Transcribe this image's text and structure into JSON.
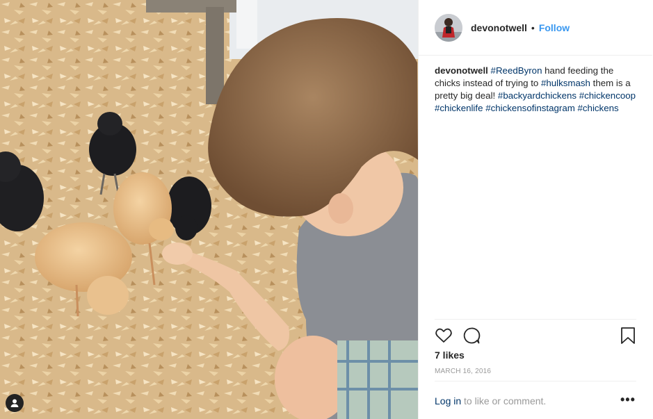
{
  "post": {
    "username": "devonotwell",
    "separator": "•",
    "follow_label": "Follow",
    "caption": {
      "username": "devonotwell",
      "parts": [
        {
          "type": "tag",
          "text": "#ReedByron"
        },
        {
          "type": "text",
          "text": " hand feeding the chicks instead of trying to "
        },
        {
          "type": "tag",
          "text": "#hulksmash"
        },
        {
          "type": "text",
          "text": " them is a pretty big deal! "
        },
        {
          "type": "tag",
          "text": "#backyardchickens"
        },
        {
          "type": "text",
          "text": " "
        },
        {
          "type": "tag",
          "text": "#chickencoop"
        },
        {
          "type": "text",
          "text": " "
        },
        {
          "type": "tag",
          "text": "#chickenlife"
        },
        {
          "type": "text",
          "text": " "
        },
        {
          "type": "tag",
          "text": "#chickensofinstagram"
        },
        {
          "type": "text",
          "text": " "
        },
        {
          "type": "tag",
          "text": "#chickens"
        }
      ]
    },
    "likes": "7 likes",
    "date": "MARCH 16, 2016",
    "footer": {
      "login_label": "Log in",
      "rest": " to like or comment."
    },
    "more_label": "•••"
  },
  "icons": {
    "like": "heart-icon",
    "comment": "comment-icon",
    "save": "bookmark-icon",
    "user_tag": "user-icon"
  },
  "colors": {
    "link_blue": "#3897f0",
    "hashtag": "#003569",
    "muted": "#999999",
    "text": "#262626"
  }
}
